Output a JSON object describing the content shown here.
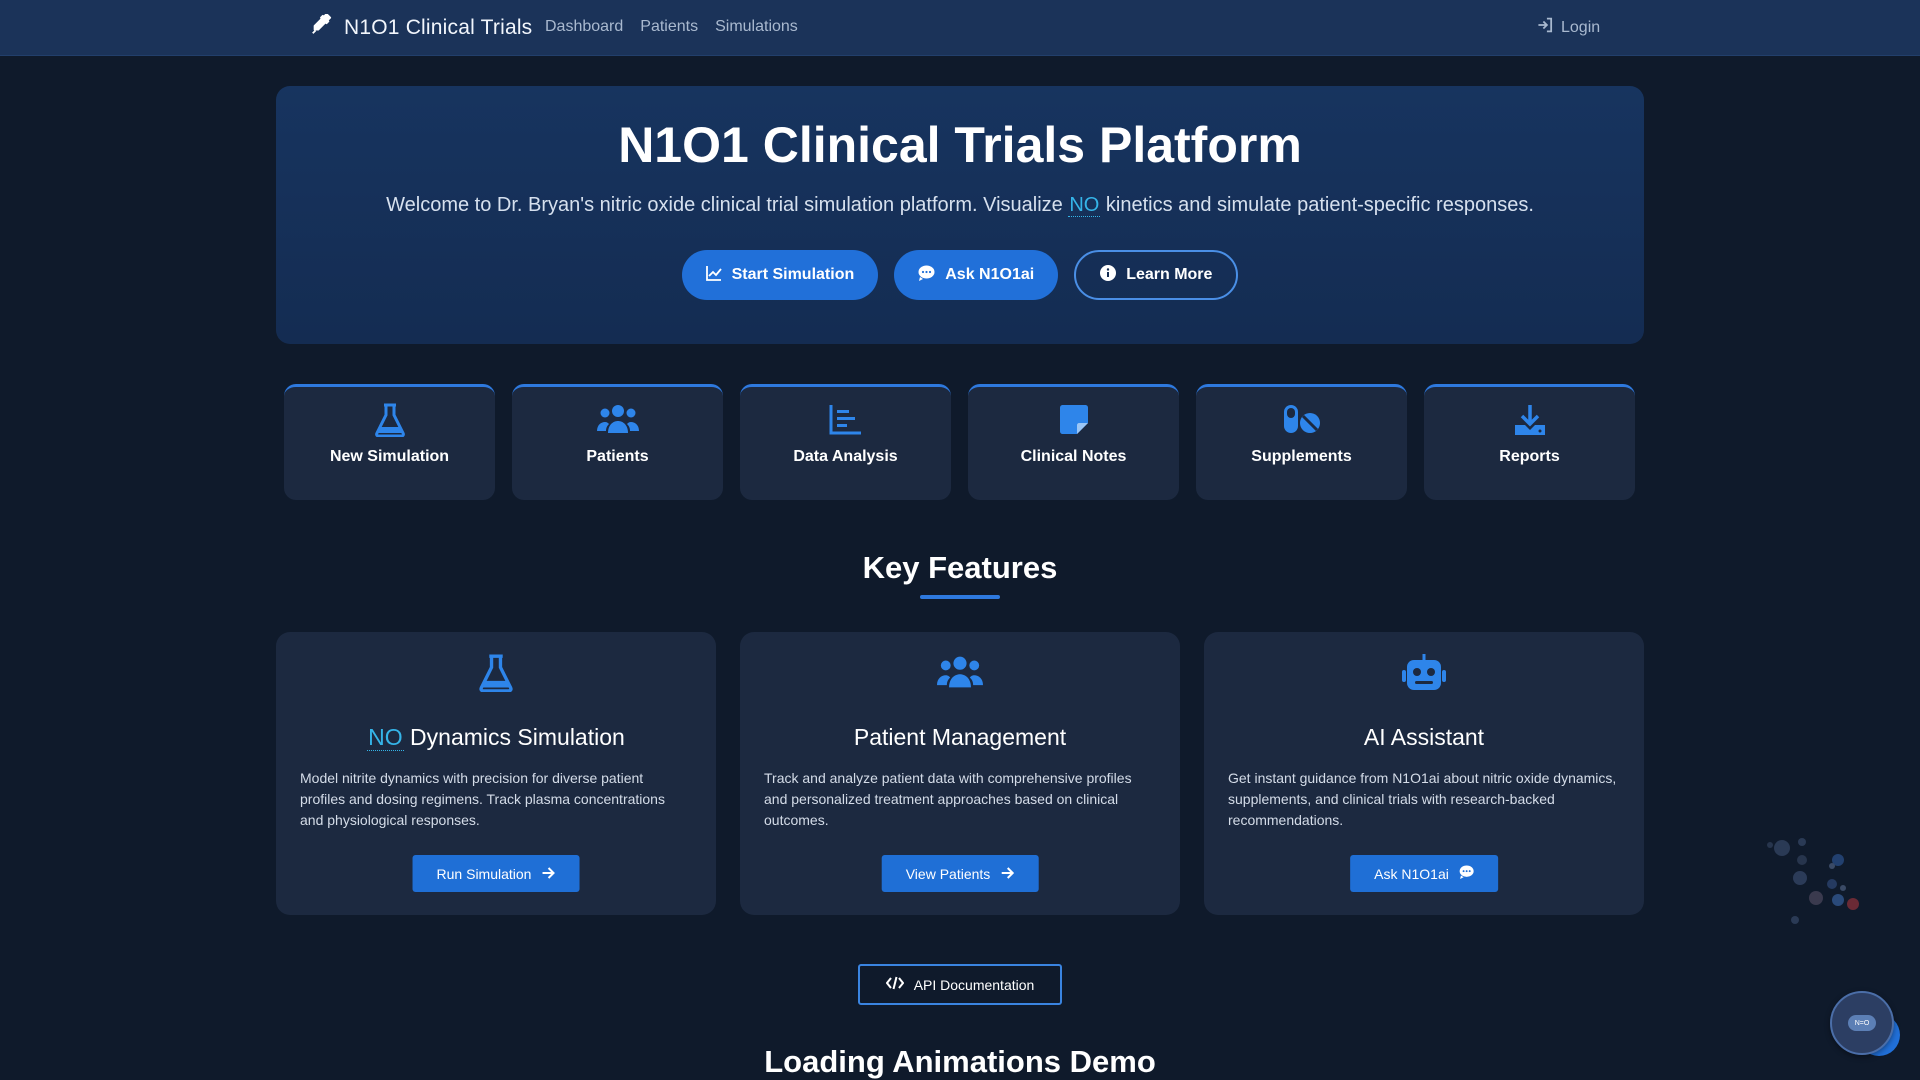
{
  "nav": {
    "brand": "N1O1 Clinical Trials",
    "brand_icon": "syringe-icon",
    "links": [
      "Dashboard",
      "Patients",
      "Simulations"
    ],
    "login": "Login"
  },
  "hero": {
    "title": "N1O1 Clinical Trials Platform",
    "subtitle_before": "Welcome to Dr. Bryan's nitric oxide clinical trial simulation platform. Visualize ",
    "subtitle_tag": "NO",
    "subtitle_after": " kinetics and simulate patient-specific responses.",
    "buttons": {
      "start": "Start Simulation",
      "ask": "Ask N1O1ai",
      "learn": "Learn More"
    }
  },
  "tiles": [
    {
      "label": "New Simulation",
      "icon": "flask-icon"
    },
    {
      "label": "Patients",
      "icon": "users-icon"
    },
    {
      "label": "Data Analysis",
      "icon": "bar-chart-icon"
    },
    {
      "label": "Clinical Notes",
      "icon": "note-icon"
    },
    {
      "label": "Supplements",
      "icon": "pills-icon"
    },
    {
      "label": "Reports",
      "icon": "download-icon"
    }
  ],
  "features": {
    "heading": "Key Features",
    "cards": [
      {
        "title_tag": "NO",
        "title": " Dynamics Simulation",
        "desc": "Model nitrite dynamics with precision for diverse patient profiles and dosing regimens. Track plasma concentrations and physiological responses.",
        "button": "Run Simulation",
        "icon": "flask-icon"
      },
      {
        "title_tag": "",
        "title": "Patient Management",
        "desc": "Track and analyze patient data with comprehensive profiles and personalized treatment approaches based on clinical outcomes.",
        "button": "View Patients",
        "icon": "users-icon"
      },
      {
        "title_tag": "",
        "title": "AI Assistant",
        "desc": "Get instant guidance from N1O1ai about nitric oxide dynamics, supplements, and clinical trials with research-backed recommendations.",
        "button": "Ask N1O1ai",
        "icon": "robot-icon"
      }
    ]
  },
  "api_button": "API Documentation",
  "loading_heading": "Loading Animations Demo",
  "chat_fab_label": "N=O",
  "colors": {
    "accent": "#2e79de",
    "background": "#0f1a2b",
    "navbar": "#1b3359",
    "card": "#1c2940",
    "no_tag": "#35b4e8"
  }
}
